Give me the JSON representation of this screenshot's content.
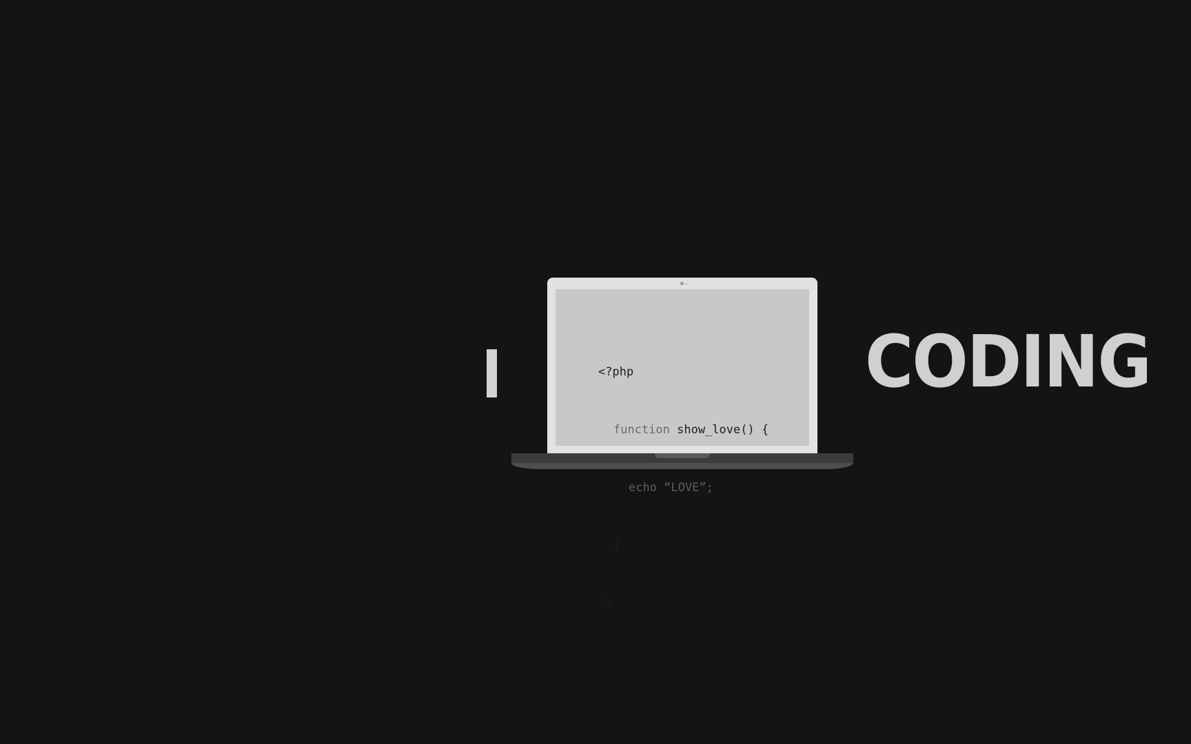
{
  "headline": {
    "left_word": "I",
    "right_word": "CODING"
  },
  "code_lines": {
    "l1": "<?php",
    "l2_keyword": "function",
    "l2_rest": " show_love() {",
    "l3_keyword": "echo",
    "l3_rest": " “LOVE”;",
    "l4": "}",
    "l5": "?>"
  },
  "colors": {
    "background": "#141414",
    "text_light": "#d0d0d0",
    "screen": "#c8c8c8",
    "lid": "#e2e2e2",
    "base": "#3c3c3c"
  }
}
